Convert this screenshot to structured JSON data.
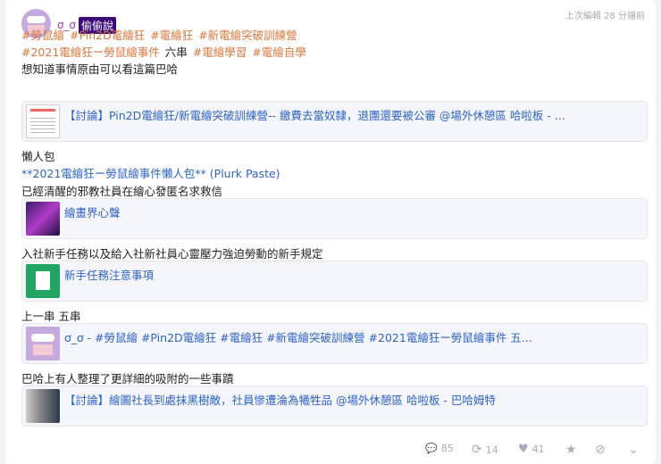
{
  "user": {
    "name": "ơ_ơ",
    "badge": "偷偷說"
  },
  "timestamp": "上次編輯 28 分鐘前",
  "tags_line1": [
    "#勞鼠繪",
    "#Pin2D電繪狂",
    "#電繪狂",
    "#新電繪突破訓練營"
  ],
  "tags_line2": {
    "tag1": "#2021電繪狂ー勞鼠繪事件",
    "text": "六串",
    "tag2": "#電繪學習",
    "tag3": "#電繪自學"
  },
  "lines": {
    "l1": "想知道事情原由可以看這篇巴哈",
    "l2": "懶人包",
    "l2_link": "**2021電繪狂ー勞鼠繪事件懶人包** (Plurk Paste)",
    "l3": "已經清醒的邪教社員在繪心發匿名求救信",
    "l4": "入社新手任務以及給入社新社員心靈壓力強迫勞動的新手規定",
    "l5": "上一串 五串",
    "l6": "巴哈上有人整理了更詳細的吸附的一些事蹟"
  },
  "link_cards": [
    {
      "title": "【討論】Pin2D電繪狂/新電繪突破訓練營-- 繳費去當奴隸，退團還要被公審 @場外休憩區 哈啦板 - ..."
    },
    {
      "title": "繪畫界心聲"
    },
    {
      "title": "新手任務注意事項"
    },
    {
      "title": "ơ_ơ - #勞鼠繪 #Pin2D電繪狂 #電繪狂 #新電繪突破訓練營 #2021電繪狂ー勞鼠繪事件 五..."
    },
    {
      "title": "【討論】繪圖社長到處抹黑樹敵，社員慘遭淪為犧牲品 @場外休憩區 哈啦板 - 巴哈姆特"
    }
  ],
  "footer": {
    "responses": "85",
    "replurks": "14",
    "likes": "41"
  }
}
